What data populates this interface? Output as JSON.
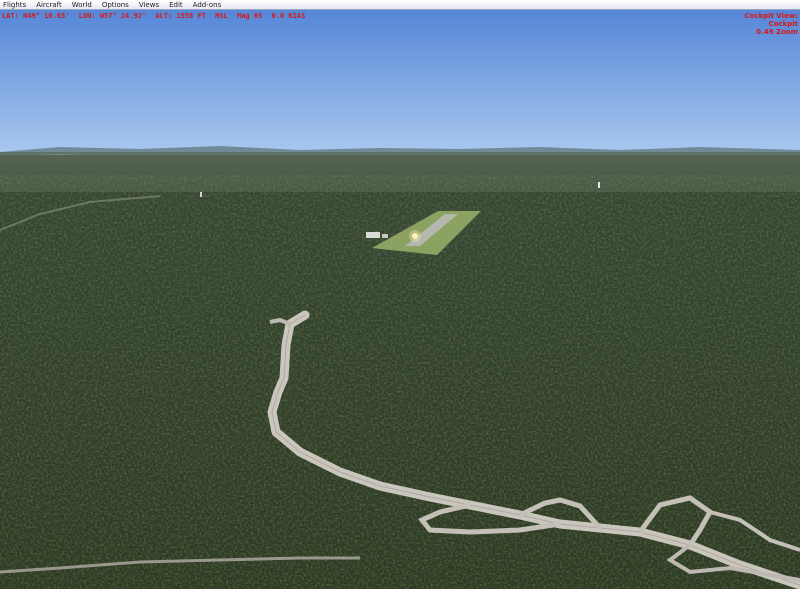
{
  "menu": {
    "items": [
      "Flights",
      "Aircraft",
      "World",
      "Options",
      "Views",
      "Edit",
      "Add-ons"
    ]
  },
  "hud": {
    "lat": "LAT: N49° 10.65'",
    "lon": "LON: W57° 24.92'",
    "alt": "ALT: 1558 FT",
    "alt_ref": "MSL",
    "heading": "Mag 65",
    "speed": "0.0 KIAS"
  },
  "view": {
    "mode": "Cockpit View:",
    "submode": "Cockpit",
    "zoom": "0.49 Zoom"
  },
  "colors": {
    "sky_top": "#4f82d6",
    "sky_horizon": "#a9c7ee",
    "forest": "#2f3c24",
    "runway_grass": "#8ca262",
    "road": "#c9c5bd",
    "hud_text": "#d81818"
  }
}
